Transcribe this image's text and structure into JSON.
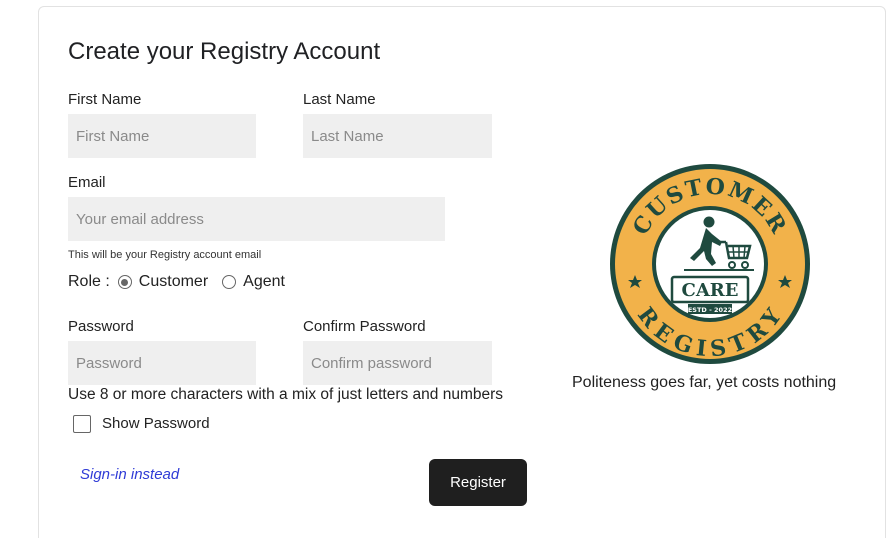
{
  "form": {
    "title": "Create your Registry Account",
    "first_name": {
      "label": "First Name",
      "placeholder": "First Name",
      "value": ""
    },
    "last_name": {
      "label": "Last Name",
      "placeholder": "Last Name",
      "value": ""
    },
    "email": {
      "label": "Email",
      "placeholder": "Your email address",
      "value": "",
      "hint": "This will be your Registry account email"
    },
    "role": {
      "label": "Role :",
      "options": [
        {
          "label": "Customer",
          "selected": true
        },
        {
          "label": "Agent",
          "selected": false
        }
      ]
    },
    "password": {
      "label": "Password",
      "placeholder": "Password",
      "value": ""
    },
    "confirm_password": {
      "label": "Confirm Password",
      "placeholder": "Confirm password",
      "value": ""
    },
    "password_hint": "Use 8 or more characters with a mix of just letters and numbers",
    "show_password": {
      "label": "Show Password",
      "checked": false
    },
    "signin_link": "Sign-in instead",
    "register_button": "Register"
  },
  "branding": {
    "logo": {
      "top_text": "CUSTOMER",
      "center_text": "CARE",
      "estd_text": "ESTD - 2022",
      "bottom_text": "REGISTRY",
      "icon": "person-pushing-cart-icon",
      "colors": {
        "ring": "#f2b24a",
        "dark": "#1f4a3f",
        "white": "#ffffff"
      }
    },
    "tagline": "Politeness goes far, yet costs nothing"
  }
}
